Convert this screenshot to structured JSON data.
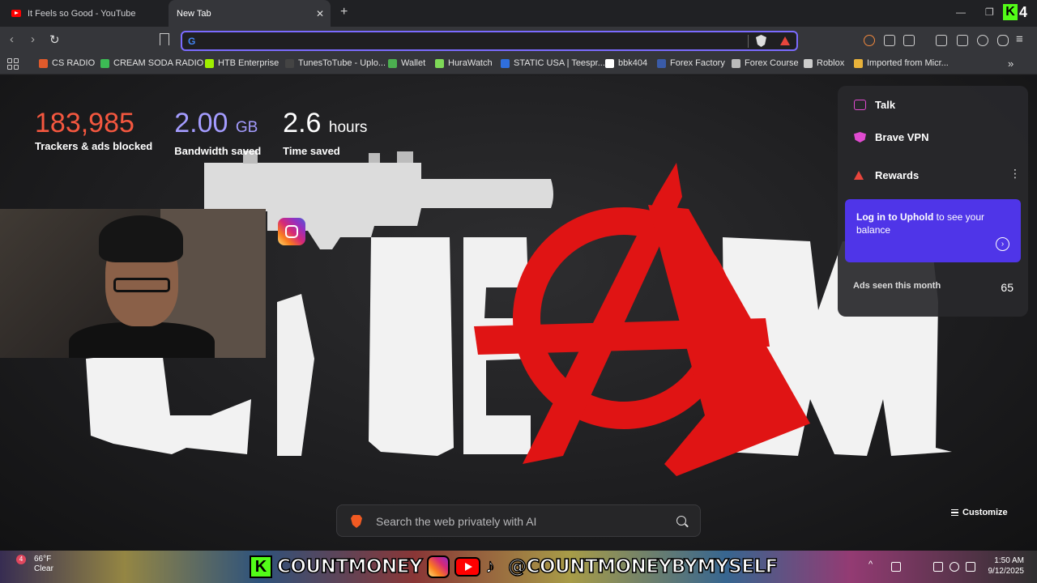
{
  "tabs": [
    {
      "title": "It Feels so Good - YouTube",
      "active": false
    },
    {
      "title": "New Tab",
      "active": true
    }
  ],
  "omnibox": {
    "value": "",
    "placeholder": ""
  },
  "bookmarks": [
    {
      "label": "CS RADIO",
      "icon": "cs-radio-icon",
      "color": "#e05a2b"
    },
    {
      "label": "CREAM SODA RADIO",
      "icon": "plus-icon",
      "color": "#3cba54"
    },
    {
      "label": "HTB Enterprise",
      "icon": "hackthebox-icon",
      "color": "#9fef00"
    },
    {
      "label": "TunesToTube - Uplo...",
      "icon": "tunestotube-icon",
      "color": "#444444"
    },
    {
      "label": "Wallet",
      "icon": "wallet-icon",
      "color": "#4caf50"
    },
    {
      "label": "HuraWatch",
      "icon": "hurawatch-icon",
      "color": "#7ed957"
    },
    {
      "label": "STATIC USA | Teespr...",
      "icon": "teespring-icon",
      "color": "#2f6fde"
    },
    {
      "label": "bbk404",
      "icon": "bars-icon",
      "color": "#ffffff"
    },
    {
      "label": "Forex Factory",
      "icon": "forex-factory-icon",
      "color": "#3a5ba8"
    },
    {
      "label": "Forex Course",
      "icon": "globe-icon",
      "color": "#bbbbbb"
    },
    {
      "label": "Roblox",
      "icon": "roblox-icon",
      "color": "#cccccc"
    },
    {
      "label": "Imported from Micr...",
      "icon": "folder-icon",
      "color": "#e8b23a"
    }
  ],
  "stats": {
    "trackers": {
      "value": "183,985",
      "label": "Trackers & ads blocked"
    },
    "bandwidth": {
      "value": "2.00",
      "unit": "GB",
      "label": "Bandwidth saved"
    },
    "time": {
      "value": "2.6",
      "unit": "hours",
      "label": "Time saved"
    }
  },
  "panel": {
    "talk": "Talk",
    "vpn": "Brave VPN",
    "rewards": "Rewards",
    "uphold_bold": "Log in to Uphold",
    "uphold_rest": " to see your balance",
    "ads_label": "Ads seen this month",
    "ads_value": "65"
  },
  "search": {
    "placeholder": "Search the web privately with AI"
  },
  "customize": "Customize",
  "taskbar": {
    "weather_temp": "66°F",
    "weather_cond": "Clear",
    "weather_badge": "4",
    "banner_left": "COUNTMONEY",
    "banner_right": "@COUNTMONEYBYMYSELF",
    "time": "1:50 AM",
    "date": "9/12/2025"
  },
  "colors": {
    "accent": "#7b6bff",
    "trackers": "#f4573f",
    "bandwidth": "#a49cff",
    "uphold": "#4f35e8",
    "anarchy_red": "#e01414"
  }
}
